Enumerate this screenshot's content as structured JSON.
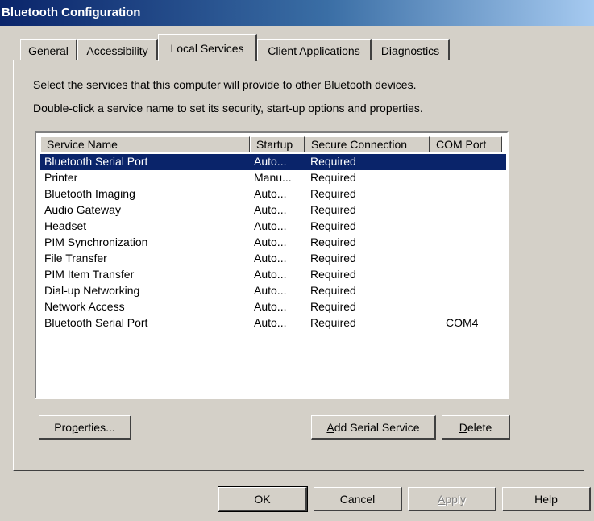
{
  "window": {
    "title": "Bluetooth Configuration"
  },
  "tabs": [
    {
      "label": "General"
    },
    {
      "label": "Accessibility"
    },
    {
      "label": "Local Services",
      "active": true
    },
    {
      "label": "Client Applications"
    },
    {
      "label": "Diagnostics"
    }
  ],
  "instructions": {
    "line1": "Select the services that this computer will provide to other Bluetooth devices.",
    "line2": "Double-click a service name to set its security, start-up options and properties."
  },
  "table": {
    "columns": [
      "Service Name",
      "Startup",
      "Secure Connection",
      "COM Port"
    ],
    "rows": [
      [
        "Bluetooth Serial Port",
        "Auto...",
        "Required",
        ""
      ],
      [
        "Printer",
        "Manu...",
        "Required",
        ""
      ],
      [
        "Bluetooth Imaging",
        "Auto...",
        "Required",
        ""
      ],
      [
        "Audio Gateway",
        "Auto...",
        "Required",
        ""
      ],
      [
        "Headset",
        "Auto...",
        "Required",
        ""
      ],
      [
        "PIM Synchronization",
        "Auto...",
        "Required",
        ""
      ],
      [
        "File Transfer",
        "Auto...",
        "Required",
        ""
      ],
      [
        "PIM Item Transfer",
        "Auto...",
        "Required",
        ""
      ],
      [
        "Dial-up Networking",
        "Auto...",
        "Required",
        ""
      ],
      [
        "Network Access",
        "Auto...",
        "Required",
        ""
      ],
      [
        "Bluetooth Serial Port",
        "Auto...",
        "Required",
        "COM4"
      ]
    ],
    "selected_row": 0
  },
  "buttons": {
    "properties": {
      "before": "Pro",
      "mnemonic": "p",
      "after": "erties..."
    },
    "add_serial": {
      "before": "",
      "mnemonic": "A",
      "after": "dd Serial Service"
    },
    "delete": {
      "before": "",
      "mnemonic": "D",
      "after": "elete"
    },
    "ok": "OK",
    "cancel": "Cancel",
    "apply": {
      "before": "",
      "mnemonic": "A",
      "after": "pply",
      "disabled": true
    },
    "help": "Help"
  }
}
